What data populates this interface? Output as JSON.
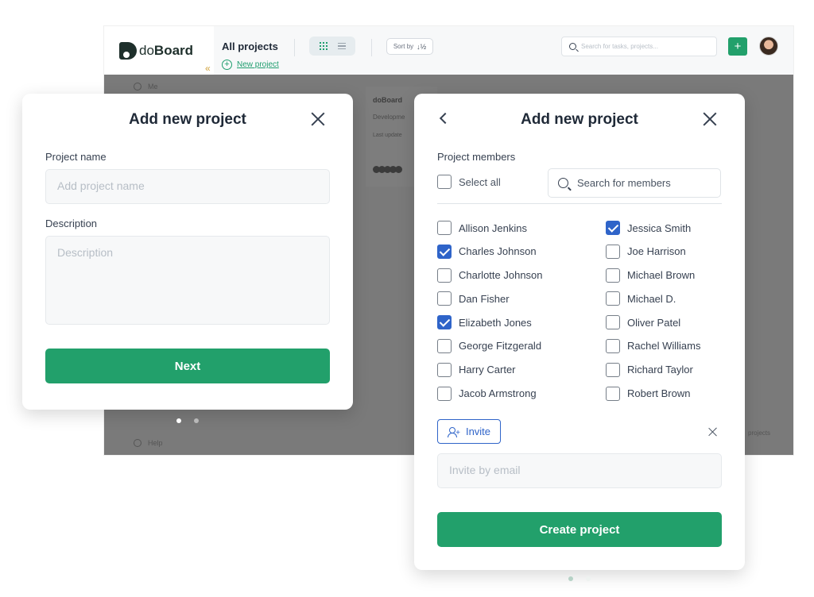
{
  "app": {
    "logo": {
      "prefix": "do",
      "suffix": "Board"
    },
    "collapse_icon": "«",
    "header": {
      "title": "All projects",
      "new_project_label": "New project",
      "sort_label": "Sort by",
      "sort_icon": "↓½",
      "search_placeholder": "Search for tasks, projects...",
      "add_label": "+"
    },
    "sidebar": {
      "me_label": "Me",
      "help_label": "Help"
    },
    "card": {
      "title": "doBoard",
      "description": "Developme",
      "updated": "Last update"
    },
    "pagination_text": "projects"
  },
  "left_modal": {
    "title": "Add new project",
    "name_label": "Project name",
    "name_placeholder": "Add project name",
    "description_label": "Description",
    "description_placeholder": "Description",
    "next_label": "Next"
  },
  "right_modal": {
    "title": "Add new project",
    "members_label": "Project members",
    "select_all_label": "Select all",
    "search_placeholder": "Search for members",
    "members_left": [
      {
        "name": "Allison Jenkins",
        "checked": false
      },
      {
        "name": "Charles Johnson",
        "checked": true
      },
      {
        "name": "Charlotte Johnson",
        "checked": false
      },
      {
        "name": "Dan Fisher",
        "checked": false
      },
      {
        "name": "Elizabeth Jones",
        "checked": true
      },
      {
        "name": "George Fitzgerald",
        "checked": false
      },
      {
        "name": "Harry Carter",
        "checked": false
      },
      {
        "name": "Jacob Armstrong",
        "checked": false
      }
    ],
    "members_right": [
      {
        "name": "Jessica Smith",
        "checked": true
      },
      {
        "name": "Joe Harrison",
        "checked": false
      },
      {
        "name": "Michael Brown",
        "checked": false
      },
      {
        "name": "Michael D.",
        "checked": false
      },
      {
        "name": "Oliver Patel",
        "checked": false
      },
      {
        "name": "Rachel Williams",
        "checked": false
      },
      {
        "name": "Richard Taylor",
        "checked": false
      },
      {
        "name": "Robert Brown",
        "checked": false
      }
    ],
    "invite_label": "Invite",
    "invite_placeholder": "Invite by email",
    "create_label": "Create project"
  },
  "colors": {
    "primary_green": "#22a06b",
    "checkbox_blue": "#2f64c9",
    "overlay_gray": "#7a7a7a"
  }
}
